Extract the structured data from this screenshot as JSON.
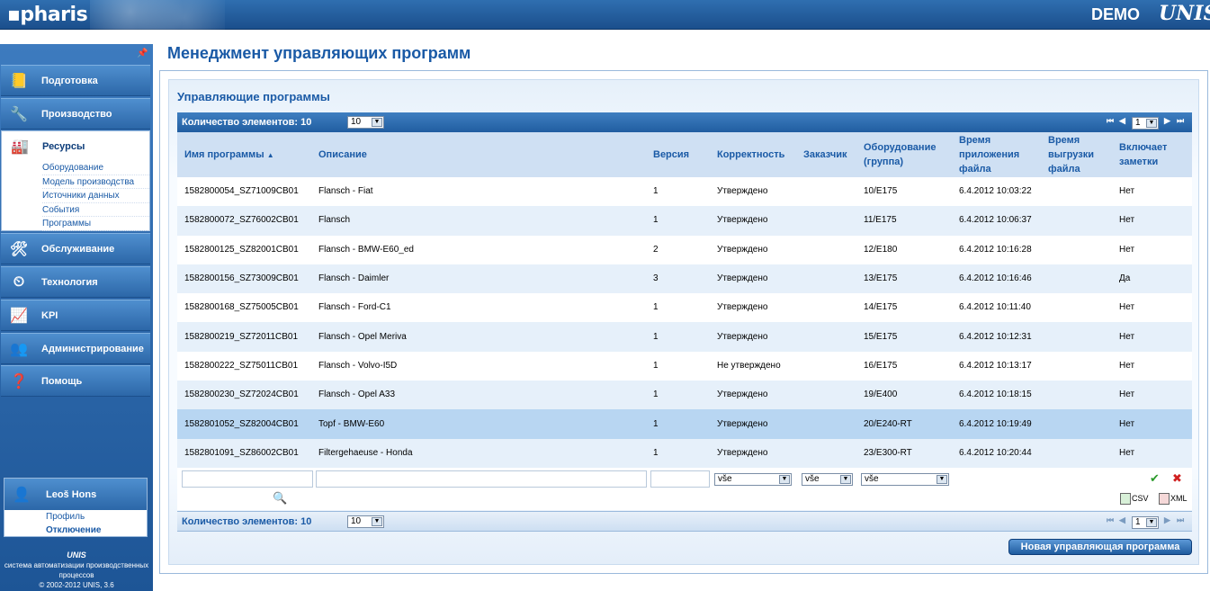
{
  "header": {
    "logo": "pharis",
    "demo": "DEMO",
    "brand": "UNIS"
  },
  "sidebar": {
    "pin_icon": "pin-icon",
    "items": [
      {
        "label": "Подготовка",
        "icon": "folder-icon"
      },
      {
        "label": "Производство",
        "icon": "tools-icon"
      },
      {
        "label": "Ресурсы",
        "icon": "machine-icon"
      },
      {
        "label": "Обслуживание",
        "icon": "wrench-icon"
      },
      {
        "label": "Технология",
        "icon": "gauge-icon"
      },
      {
        "label": "KPI",
        "icon": "chart-icon"
      },
      {
        "label": "Администрирование",
        "icon": "users-icon"
      },
      {
        "label": "Помощь",
        "icon": "help-icon"
      }
    ],
    "sub_items": [
      "Оборудование",
      "Модель производства",
      "Источники данных",
      "События",
      "Программы"
    ],
    "user": {
      "name": "Leoš Hons",
      "profile": "Профиль",
      "logout": "Отключение"
    },
    "footer": {
      "brand": "UNIS",
      "text1": "система автоматизации производственных",
      "text2": "процессов",
      "text3": "© 2002-2012 UNIS, 3.6"
    }
  },
  "main": {
    "page_title": "Менеджмент управляющих программ",
    "panel_title": "Управляющие программы",
    "count_label": "Количество элементов: 10",
    "page_size": "10",
    "page_number": "1",
    "columns": [
      "Имя программы",
      "Описание",
      "Версия",
      "Корректность",
      "Заказчик",
      "Оборудование (группа)",
      "Время приложения файла",
      "Время выгрузки файла",
      "Включает заметки"
    ],
    "sort_indicator": "▲",
    "rows": [
      [
        "1582800054_SZ71009CB01",
        "Flansch - Fiat",
        "1",
        "Утверждено",
        "",
        "10/E175",
        "6.4.2012 10:03:22",
        "",
        "Нет"
      ],
      [
        "1582800072_SZ76002CB01",
        "Flansch",
        "1",
        "Утверждено",
        "",
        "11/E175",
        "6.4.2012 10:06:37",
        "",
        "Нет"
      ],
      [
        "1582800125_SZ82001CB01",
        "Flansch - BMW-E60_ed",
        "2",
        "Утверждено",
        "",
        "12/E180",
        "6.4.2012 10:16:28",
        "",
        "Нет"
      ],
      [
        "1582800156_SZ73009CB01",
        "Flansch - Daimler",
        "3",
        "Утверждено",
        "",
        "13/E175",
        "6.4.2012 10:16:46",
        "",
        "Да"
      ],
      [
        "1582800168_SZ75005CB01",
        "Flansch - Ford-C1",
        "1",
        "Утверждено",
        "",
        "14/E175",
        "6.4.2012 10:11:40",
        "",
        "Нет"
      ],
      [
        "1582800219_SZ72011CB01",
        "Flansch - Opel Meriva",
        "1",
        "Утверждено",
        "",
        "15/E175",
        "6.4.2012 10:12:31",
        "",
        "Нет"
      ],
      [
        "1582800222_SZ75011CB01",
        "Flansch - Volvo-I5D",
        "1",
        "Не утверждено",
        "",
        "16/E175",
        "6.4.2012 10:13:17",
        "",
        "Нет"
      ],
      [
        "1582800230_SZ72024CB01",
        "Flansch - Opel A33",
        "1",
        "Утверждено",
        "",
        "19/E400",
        "6.4.2012 10:18:15",
        "",
        "Нет"
      ],
      [
        "1582801052_SZ82004CB01",
        "Topf - BMW-E60",
        "1",
        "Утверждено",
        "",
        "20/E240-RT",
        "6.4.2012 10:19:49",
        "",
        "Нет"
      ],
      [
        "1582801091_SZ86002CB01",
        "Filtergehaeuse - Honda",
        "1",
        "Утверждено",
        "",
        "23/E300-RT",
        "6.4.2012 10:20:44",
        "",
        "Нет"
      ]
    ],
    "filters": {
      "korrekt": "vše",
      "zakaznik": "vše",
      "oborud": "vše"
    },
    "export": {
      "csv": "CSV",
      "xml": "XML"
    },
    "new_button": "Новая управляющая программа"
  }
}
